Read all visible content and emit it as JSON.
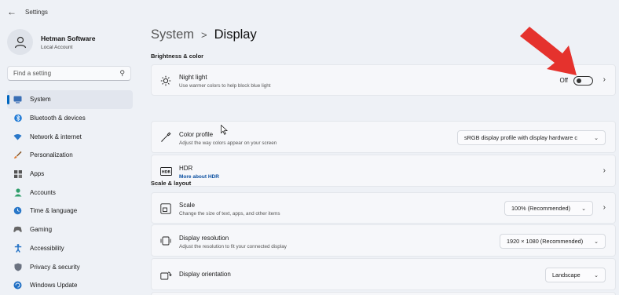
{
  "app": {
    "title": "Settings"
  },
  "profile": {
    "name": "Hetman Software",
    "account": "Local Account"
  },
  "search": {
    "placeholder": "Find a setting"
  },
  "sidebar": {
    "items": [
      {
        "label": "System",
        "icon": "monitor-icon",
        "active": true
      },
      {
        "label": "Bluetooth & devices",
        "icon": "bluetooth-icon"
      },
      {
        "label": "Network & internet",
        "icon": "wifi-icon"
      },
      {
        "label": "Personalization",
        "icon": "brush-icon"
      },
      {
        "label": "Apps",
        "icon": "apps-icon"
      },
      {
        "label": "Accounts",
        "icon": "person-icon"
      },
      {
        "label": "Time & language",
        "icon": "globe-clock-icon"
      },
      {
        "label": "Gaming",
        "icon": "gamepad-icon"
      },
      {
        "label": "Accessibility",
        "icon": "accessibility-icon"
      },
      {
        "label": "Privacy & security",
        "icon": "shield-icon"
      },
      {
        "label": "Windows Update",
        "icon": "update-icon"
      }
    ]
  },
  "breadcrumb": {
    "parent": "System",
    "separator": ">",
    "current": "Display"
  },
  "sections": {
    "brightness": {
      "title": "Brightness & color"
    },
    "scale": {
      "title": "Scale & layout"
    }
  },
  "cards": {
    "night_light": {
      "title": "Night light",
      "subtitle": "Use warmer colors to help block blue light",
      "state": "Off"
    },
    "color_profile": {
      "title": "Color profile",
      "subtitle": "Adjust the way colors appear on your screen",
      "value": "sRGB display profile with display hardware c"
    },
    "hdr": {
      "title": "HDR",
      "link": "More about HDR"
    },
    "scale": {
      "title": "Scale",
      "subtitle": "Change the size of text, apps, and other items",
      "value": "100% (Recommended)"
    },
    "resolution": {
      "title": "Display resolution",
      "subtitle": "Adjust the resolution to fit your connected display",
      "value": "1920 × 1080 (Recommended)"
    },
    "orientation": {
      "title": "Display orientation",
      "value": "Landscape"
    }
  },
  "colors": {
    "accent": "#0067c0",
    "arrow": "#e5322d"
  }
}
